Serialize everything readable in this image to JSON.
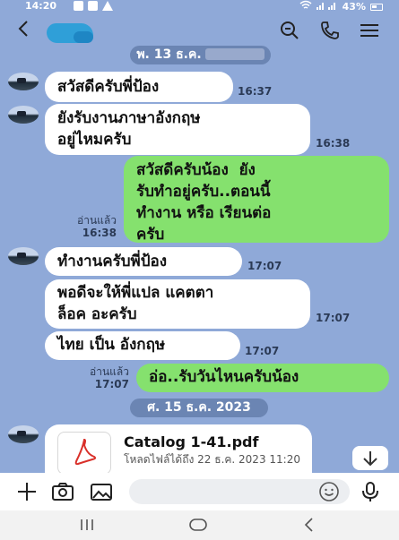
{
  "status_bar": {
    "time": "14:20",
    "battery": "43%"
  },
  "header": {
    "back_icon": "chevron-left-icon",
    "search_icon": "search-icon",
    "call_icon": "phone-icon",
    "menu_icon": "menu-icon"
  },
  "chat": {
    "date_separator_1": "พ. 13 ธ.ค.",
    "messages": [
      {
        "side": "in",
        "text": "สวัสดีครับพี่ป้อง",
        "time": "16:37"
      },
      {
        "side": "in",
        "text": "ยังรับงานภาษาอังกฤษ\nอยู่ไหมครับ",
        "time": "16:38"
      },
      {
        "side": "out",
        "text": "สวัสดีครับน้อง  ยัง\nรับทำอยู่ครับ..ตอนนี้\nทำงาน หรือ เรียนต่อ\nครับ",
        "read_label": "อ่านแล้ว",
        "time": "16:38"
      },
      {
        "side": "in",
        "text": "ทำงานครับพี่ป้อง",
        "time": "17:07"
      },
      {
        "side": "in",
        "text": "พอดีจะให้พี่แปล แคตตา\nล็อค อะครับ",
        "time": "17:07"
      },
      {
        "side": "in",
        "text": "ไทย เป็น อังกฤษ",
        "time": "17:07"
      },
      {
        "side": "out",
        "text": "อ่อ..รับวันไหนครับน้อง",
        "read_label": "อ่านแล้ว",
        "time": "17:07"
      }
    ],
    "date_separator_2": "ศ. 15 ธ.ค. 2023",
    "file": {
      "name": "Catalog 1-41.pdf",
      "subtitle": "โหลดไฟล์ได้ถึง 22 ธ.ค. 2023 11:20",
      "icon": "pdf-icon"
    },
    "scroll_down_icon": "arrow-down-icon"
  },
  "input_bar": {
    "plus_icon": "plus-icon",
    "camera_icon": "camera-icon",
    "gallery_icon": "image-icon",
    "emoji_icon": "emoji-icon",
    "mic_icon": "microphone-icon",
    "placeholder": ""
  },
  "nav_bar": {
    "recents_icon": "recent-apps-icon",
    "home_icon": "home-icon",
    "back_icon": "back-icon"
  },
  "colors": {
    "chat_background": "#8fa9d8",
    "incoming_bubble": "#ffffff",
    "outgoing_bubble": "#85e16e",
    "date_pill": "#6b85b3"
  }
}
